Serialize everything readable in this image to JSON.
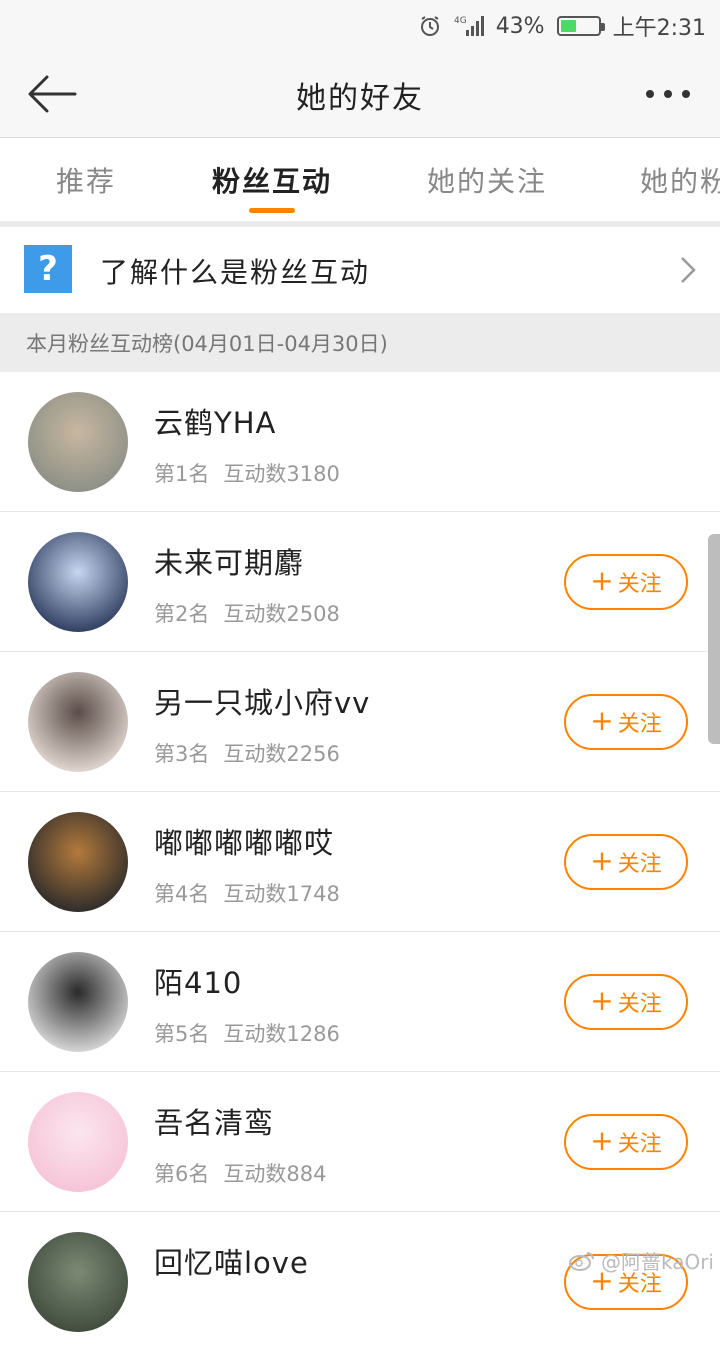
{
  "status": {
    "network": "4G",
    "battery_percent": "43%",
    "battery_level": 0.43,
    "time": "上午2:31"
  },
  "header": {
    "title": "她的好友"
  },
  "tabs": [
    {
      "label": "推荐",
      "active": false
    },
    {
      "label": "粉丝互动",
      "active": true
    },
    {
      "label": "她的关注",
      "active": false
    },
    {
      "label": "她的粉",
      "active": false
    }
  ],
  "info": {
    "icon": "question-icon",
    "label": "了解什么是粉丝互动"
  },
  "section": {
    "title": "本月粉丝互动榜(04月01日-04月30日)"
  },
  "follow_label": "关注",
  "fans": [
    {
      "name": "云鹤YHA",
      "rank": "第1名",
      "count": "互动数3180",
      "show_follow": false,
      "avatar_colors": [
        "#8a8f86",
        "#c9b7a0"
      ]
    },
    {
      "name": "未来可期麝",
      "rank": "第2名",
      "count": "互动数2508",
      "show_follow": true,
      "avatar_colors": [
        "#2b3a5c",
        "#c7d6f0"
      ]
    },
    {
      "name": "另一只城小府vv",
      "rank": "第3名",
      "count": "互动数2256",
      "show_follow": true,
      "avatar_colors": [
        "#e6dcd5",
        "#5a4c48"
      ]
    },
    {
      "name": "嘟嘟嘟嘟嘟哎",
      "rank": "第4名",
      "count": "互动数1748",
      "show_follow": true,
      "avatar_colors": [
        "#2a2a2a",
        "#b47a3c"
      ]
    },
    {
      "name": "陌410",
      "rank": "第5名",
      "count": "互动数1286",
      "show_follow": true,
      "avatar_colors": [
        "#dcdcdc",
        "#2a2a2a"
      ]
    },
    {
      "name": "吾名清鸾",
      "rank": "第6名",
      "count": "互动数884",
      "show_follow": true,
      "avatar_colors": [
        "#f6c3d6",
        "#fbe6ee"
      ]
    },
    {
      "name": "回忆喵love",
      "rank": "",
      "count": "",
      "show_follow": true,
      "avatar_colors": [
        "#3f4a3c",
        "#7c8a75"
      ]
    }
  ],
  "watermark": "@阿蔷kaOri"
}
